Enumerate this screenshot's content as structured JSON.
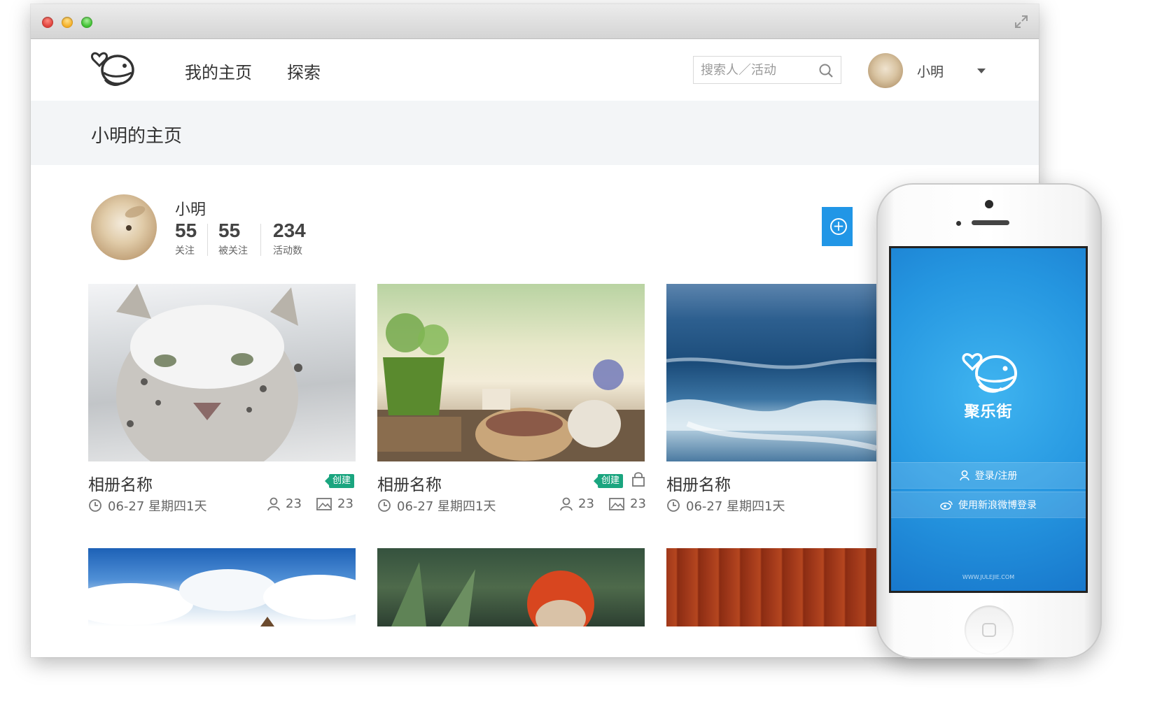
{
  "nav": {
    "home_label": "我的主页",
    "explore_label": "探索",
    "search_placeholder": "搜索人／活动",
    "username": "小明"
  },
  "page": {
    "title": "小明的主页"
  },
  "profile": {
    "name": "小明",
    "stats": [
      {
        "value": "55",
        "label": "关注"
      },
      {
        "value": "55",
        "label": "被关注"
      },
      {
        "value": "234",
        "label": "活动数"
      }
    ]
  },
  "albums": [
    {
      "title": "相册名称",
      "badge": "创建",
      "locked": false,
      "date": "06-27 星期四1天",
      "members": "23",
      "photos": "23",
      "image": "snow-leopard"
    },
    {
      "title": "相册名称",
      "badge": "创建",
      "locked": true,
      "date": "06-27 星期四1天",
      "members": "23",
      "photos": "23",
      "image": "tea-table"
    },
    {
      "title": "相册名称",
      "badge": "",
      "locked": false,
      "date": "06-27 星期四1天",
      "members": "",
      "photos": "",
      "image": "ocean-waves"
    },
    {
      "title": "",
      "image": "sky-clouds"
    },
    {
      "title": "",
      "image": "rabbit-in-plants"
    },
    {
      "title": "",
      "image": "red-wood"
    }
  ],
  "phone": {
    "app_name": "聚乐街",
    "login_label": "登录/注册",
    "weibo_label": "使用新浪微博登录",
    "url": "WWW.JULEJIE.COM"
  },
  "colors": {
    "accent_blue": "#2196e6",
    "badge_green": "#1aa57f",
    "header_bg": "#f3f5f7"
  }
}
